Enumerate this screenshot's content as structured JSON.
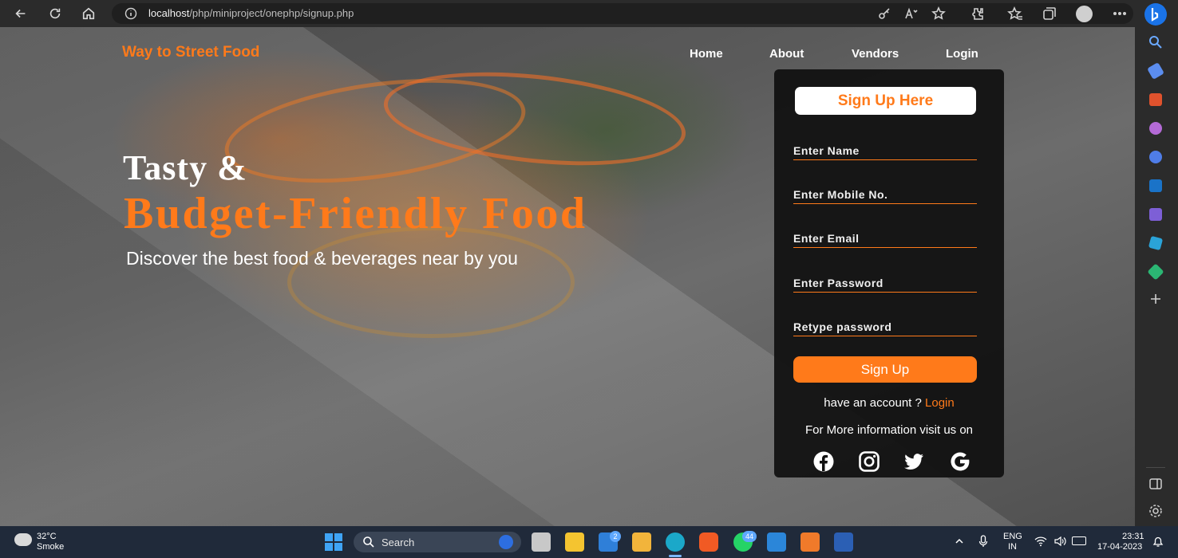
{
  "browser": {
    "url_host": "localhost",
    "url_path": "/php/miniproject/onephp/signup.php"
  },
  "site": {
    "brand": "Way to Street Food",
    "nav": [
      {
        "label": "Home"
      },
      {
        "label": "About"
      },
      {
        "label": "Vendors"
      },
      {
        "label": "Login"
      }
    ]
  },
  "hero": {
    "line1": "Tasty &",
    "line2": "Budget-Friendly Food",
    "subtitle": "Discover the best food & beverages near by you"
  },
  "signup": {
    "title": "Sign Up Here",
    "fields": {
      "name": "Enter Name",
      "mobile": "Enter Mobile No.",
      "email": "Enter Email",
      "password": "Enter Password",
      "retype": "Retype password"
    },
    "button": "Sign Up",
    "have_account": "have an account ?",
    "login_link": "Login",
    "more_info": "For More information visit us on",
    "social": [
      "facebook-icon",
      "instagram-icon",
      "twitter-icon",
      "google-icon"
    ]
  },
  "taskbar": {
    "weather_temp": "32°C",
    "weather_desc": "Smoke",
    "search_label": "Search",
    "mail_badge": "2",
    "whatsapp_badge": "44",
    "lang_line1": "ENG",
    "lang_line2": "IN",
    "time": "23:31",
    "date": "17-04-2023"
  },
  "colors": {
    "accent": "#ff7a1a",
    "panel": "#111111",
    "taskbar": "#202a3a"
  }
}
